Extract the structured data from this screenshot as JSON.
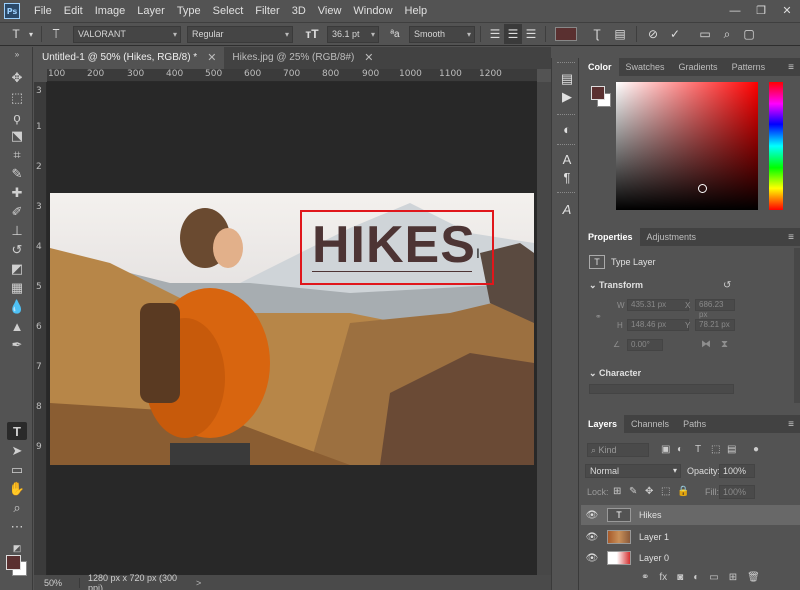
{
  "menubar": {
    "items": [
      "File",
      "Edit",
      "Image",
      "Layer",
      "Type",
      "Select",
      "Filter",
      "3D",
      "View",
      "Window",
      "Help"
    ],
    "logo": "Ps"
  },
  "options": {
    "font_family": "VALORANT",
    "font_style": "Regular",
    "font_size": "36.1 pt",
    "antialias": "Smooth",
    "color": "#5a3030"
  },
  "tabs": [
    {
      "label": "Untitled-1 @ 50% (Hikes, RGB/8) *",
      "active": true
    },
    {
      "label": "Hikes.jpg @ 25% (RGB/8#)",
      "active": false
    }
  ],
  "rulers": {
    "h_labels": [
      "100",
      "200",
      "300",
      "400",
      "500",
      "600",
      "700",
      "800",
      "900",
      "1000",
      "1100",
      "1200"
    ],
    "v_labels": [
      "3",
      "1",
      "2",
      "3",
      "4",
      "5",
      "6",
      "7",
      "8",
      "9"
    ]
  },
  "canvas": {
    "text": "HIKES",
    "cursor": "I"
  },
  "status": {
    "zoom": "50%",
    "doc_info": "1280 px x 720 px (300 ppi)",
    "arrow": ">"
  },
  "color_panel": {
    "tabs": [
      "Color",
      "Swatches",
      "Gradients",
      "Patterns"
    ],
    "fg": "#5a3030",
    "bg": "#ffffff"
  },
  "properties": {
    "tabs": [
      "Properties",
      "Adjustments"
    ],
    "layer_type": "Type Layer",
    "transform_label": "Transform",
    "W": "435.31 px",
    "X": "686.23 px",
    "H": "148.46 px",
    "Y": "78.21 px",
    "angle": "0.00°",
    "character_label": "Character"
  },
  "layers": {
    "tabs": [
      "Layers",
      "Channels",
      "Paths"
    ],
    "filter_placeholder": "Kind",
    "blend_mode": "Normal",
    "opacity_label": "Opacity:",
    "opacity": "100%",
    "lock_label": "Lock:",
    "fill_label": "Fill:",
    "fill": "100%",
    "items": [
      {
        "name": "Hikes",
        "type": "text",
        "selected": true
      },
      {
        "name": "Layer 1",
        "type": "photo",
        "selected": false
      },
      {
        "name": "Layer 0",
        "type": "red",
        "selected": false
      }
    ]
  }
}
